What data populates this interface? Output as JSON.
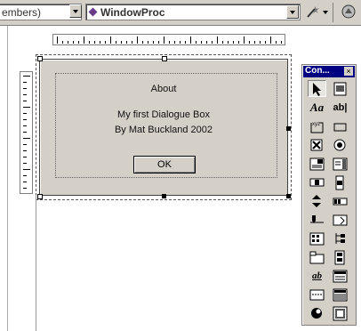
{
  "toolbar": {
    "members_combo": "embers)",
    "proc_combo": "WindowProc"
  },
  "dialog": {
    "title": "About",
    "line1": "My first Dialogue Box",
    "line2": "By Mat Buckland 2002",
    "ok_label": "OK"
  },
  "palette": {
    "title": "Con...",
    "close": "×",
    "tools": [
      {
        "id": "pointer",
        "icon": "arrow-pointer-icon"
      },
      {
        "id": "picture",
        "icon": "picture-icon"
      },
      {
        "id": "static-text",
        "icon": "static-text-icon",
        "glyph": "Aa"
      },
      {
        "id": "edit-box",
        "icon": "edit-box-icon",
        "glyph": "ab|"
      },
      {
        "id": "group-box",
        "icon": "group-box-icon"
      },
      {
        "id": "button",
        "icon": "button-icon"
      },
      {
        "id": "check-box",
        "icon": "check-box-icon"
      },
      {
        "id": "radio-button",
        "icon": "radio-button-icon"
      },
      {
        "id": "combo-box",
        "icon": "combo-box-icon"
      },
      {
        "id": "list-box",
        "icon": "list-box-icon"
      },
      {
        "id": "h-scroll",
        "icon": "horizontal-scroll-icon"
      },
      {
        "id": "v-scroll",
        "icon": "vertical-scroll-icon"
      },
      {
        "id": "spin",
        "icon": "spin-icon"
      },
      {
        "id": "progress",
        "icon": "progress-icon"
      },
      {
        "id": "slider",
        "icon": "slider-icon"
      },
      {
        "id": "hotkey",
        "icon": "hotkey-icon"
      },
      {
        "id": "list-control",
        "icon": "list-control-icon"
      },
      {
        "id": "tree",
        "icon": "tree-control-icon"
      },
      {
        "id": "tab",
        "icon": "tab-control-icon"
      },
      {
        "id": "animate",
        "icon": "animate-icon"
      },
      {
        "id": "rich-edit",
        "icon": "rich-edit-icon",
        "glyph": "ab"
      },
      {
        "id": "date-time",
        "icon": "date-time-icon"
      },
      {
        "id": "month-cal",
        "icon": "month-calendar-icon"
      },
      {
        "id": "ip-address",
        "icon": "ip-address-icon"
      },
      {
        "id": "custom",
        "icon": "custom-control-icon"
      },
      {
        "id": "extended-combo",
        "icon": "extended-combo-icon"
      }
    ]
  }
}
